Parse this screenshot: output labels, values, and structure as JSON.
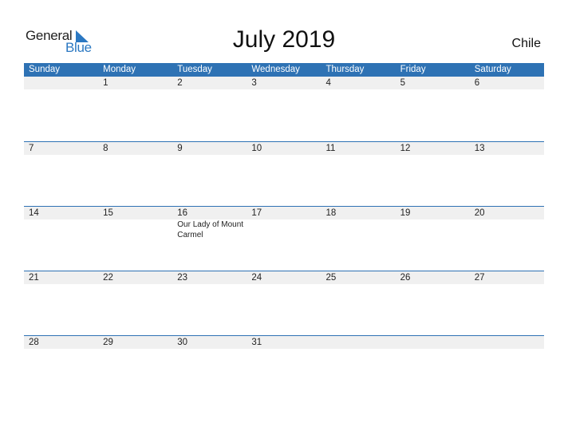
{
  "logo": {
    "line1": "General",
    "line2": "Blue"
  },
  "title": "July 2019",
  "country": "Chile",
  "colors": {
    "header": "#2e72b4",
    "accent": "#2b78c2",
    "day_row": "#f0f0f0"
  },
  "weekdays": [
    "Sunday",
    "Monday",
    "Tuesday",
    "Wednesday",
    "Thursday",
    "Friday",
    "Saturday"
  ],
  "weeks": [
    {
      "days": [
        "",
        "1",
        "2",
        "3",
        "4",
        "5",
        "6"
      ],
      "events": [
        "",
        "",
        "",
        "",
        "",
        "",
        ""
      ]
    },
    {
      "days": [
        "7",
        "8",
        "9",
        "10",
        "11",
        "12",
        "13"
      ],
      "events": [
        "",
        "",
        "",
        "",
        "",
        "",
        ""
      ]
    },
    {
      "days": [
        "14",
        "15",
        "16",
        "17",
        "18",
        "19",
        "20"
      ],
      "events": [
        "",
        "",
        "Our Lady of Mount Carmel",
        "",
        "",
        "",
        ""
      ]
    },
    {
      "days": [
        "21",
        "22",
        "23",
        "24",
        "25",
        "26",
        "27"
      ],
      "events": [
        "",
        "",
        "",
        "",
        "",
        "",
        ""
      ]
    },
    {
      "days": [
        "28",
        "29",
        "30",
        "31",
        "",
        "",
        ""
      ],
      "events": [
        "",
        "",
        "",
        "",
        "",
        "",
        ""
      ]
    }
  ]
}
